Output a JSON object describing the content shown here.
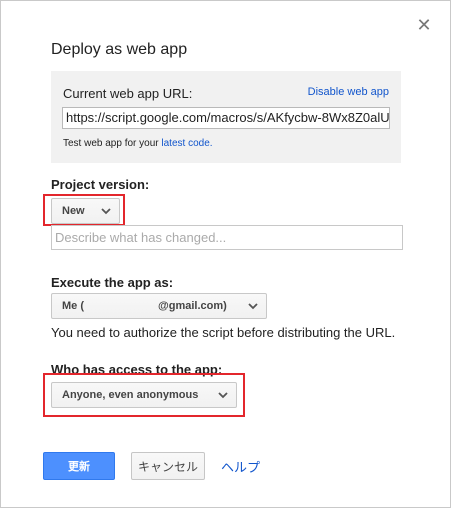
{
  "dialog": {
    "title": "Deploy as web app",
    "close_icon": "✕"
  },
  "url_section": {
    "label": "Current web app URL:",
    "disable_link": "Disable web app",
    "url_value": "https://script.google.com/macros/s/AKfycbw-8Wx8Z0alU",
    "note_prefix": "Test web app for your ",
    "note_link": "latest code."
  },
  "project_version": {
    "label": "Project version:",
    "selected": "New",
    "description_placeholder": "Describe what has changed..."
  },
  "execute_as": {
    "label": "Execute the app as:",
    "selected_prefix": "Me (",
    "selected_suffix": "@gmail.com)",
    "note": "You need to authorize the script before distributing the URL."
  },
  "access": {
    "label": "Who has access to the app:",
    "selected": "Anyone, even anonymous"
  },
  "buttons": {
    "update": "更新",
    "cancel": "キャンセル",
    "help": "ヘルプ"
  },
  "colors": {
    "primary": "#4d90fe",
    "link": "#1155cc",
    "highlight": "#e3262c"
  }
}
